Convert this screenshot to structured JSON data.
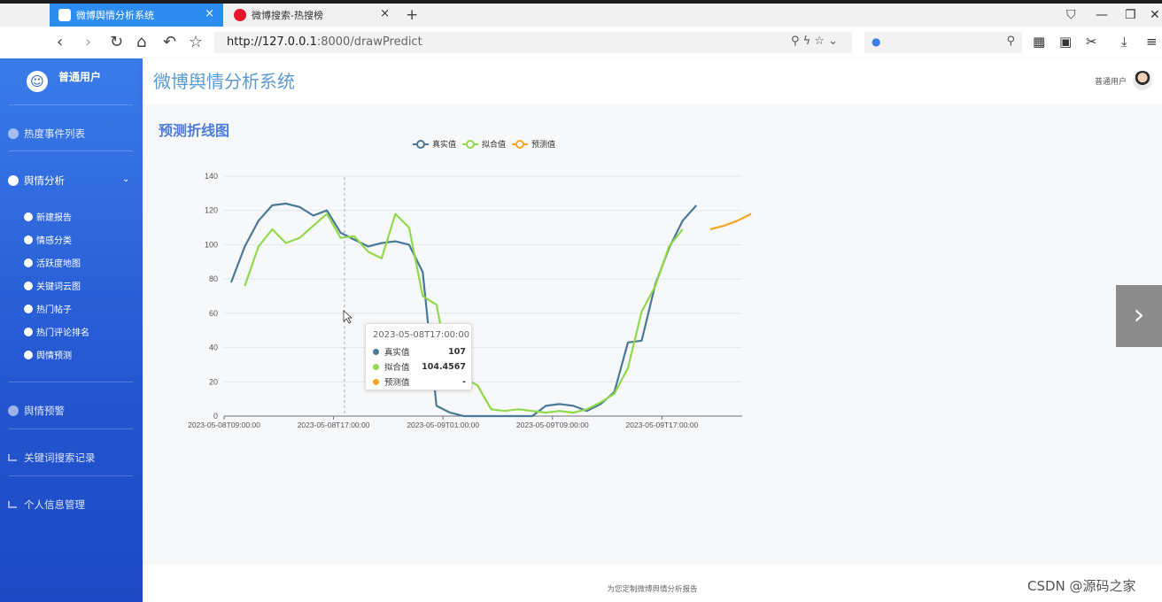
{
  "browser": {
    "tabs": [
      {
        "label": "微博舆情分析系统",
        "active": true
      },
      {
        "label": "微博搜索-热搜榜",
        "active": false
      }
    ],
    "new_tab": "+",
    "url_host": "http://127.0.0.1",
    "url_path": ":8000/drawPredict",
    "close_glyph": "×"
  },
  "sidebar": {
    "username": "普通用户",
    "items": [
      {
        "label": "热度事件列表"
      },
      {
        "label": "舆情分析"
      },
      {
        "label": "舆情预警"
      },
      {
        "label": "关键词搜索记录"
      },
      {
        "label": "个人信息管理"
      }
    ],
    "sub_items": [
      {
        "label": "新建报告"
      },
      {
        "label": "情感分类"
      },
      {
        "label": "活跃度地图"
      },
      {
        "label": "关键词云图"
      },
      {
        "label": "热门帖子"
      },
      {
        "label": "热门评论排名"
      },
      {
        "label": "舆情预测"
      }
    ]
  },
  "header": {
    "app_title": "微博舆情分析系统",
    "user_label": "普通用户"
  },
  "main": {
    "page_title": "预测折线图"
  },
  "tooltip": {
    "time": "2023-05-08T17:00:00",
    "rows": [
      {
        "name": "真实值",
        "value": "107"
      },
      {
        "name": "拟合值",
        "value": "104.4567"
      },
      {
        "name": "预测值",
        "value": "-"
      }
    ]
  },
  "footer": {
    "text": "为您定制微博舆情分析报告",
    "watermark": "CSDN @源码之家"
  },
  "colors": {
    "actual": "#4a7a95",
    "fitted": "#91d94d",
    "predicted": "#f5a623",
    "title_blue": "#5b9bd5",
    "sidebar": "#2456d0"
  },
  "chart_data": {
    "type": "line",
    "legend": [
      "真实值",
      "拟合值",
      "预测值"
    ],
    "legend_position": "top-center",
    "ylim": [
      0,
      140
    ],
    "yticks": [
      "0",
      "20",
      "40",
      "60",
      "80",
      "100",
      "120",
      "140"
    ],
    "xticks": [
      "2023-05-08T09:00:00",
      "2023-05-08T17:00:00",
      "2023-05-09T01:00:00",
      "2023-05-09T09:00:00",
      "2023-05-09T17:00:00"
    ],
    "x_start_hour_of_tick0": 0,
    "series": [
      {
        "name": "真实值",
        "color": "#4a7a95",
        "start_index": 0,
        "values": [
          78,
          99,
          114,
          123,
          124,
          122,
          117,
          120,
          107,
          103,
          99,
          101,
          102,
          100,
          84,
          6,
          2,
          0,
          0,
          0,
          0,
          0,
          0,
          6,
          7,
          6,
          3,
          7,
          14,
          43,
          44,
          77,
          98,
          114,
          123
        ]
      },
      {
        "name": "拟合值",
        "color": "#91d94d",
        "start_index": 1,
        "values": [
          76,
          99,
          109,
          101,
          104,
          111,
          118,
          104,
          105,
          96,
          92,
          118,
          110,
          70,
          65,
          25,
          22,
          18,
          4,
          3,
          4,
          3,
          2,
          3,
          2,
          4,
          8,
          13,
          28,
          61,
          76,
          99,
          109
        ]
      },
      {
        "name": "预测值",
        "color": "#f5a623",
        "start_index": 35,
        "values": [
          109,
          111,
          114,
          118
        ]
      }
    ]
  }
}
